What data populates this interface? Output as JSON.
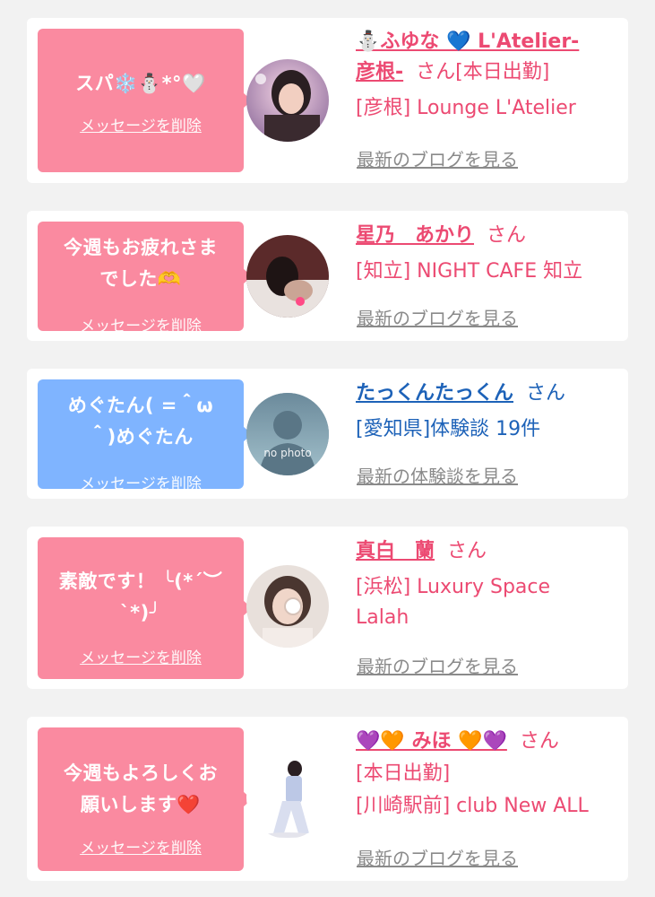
{
  "cards": [
    {
      "bubble_color": "#fa8aa0",
      "message": "スパ❄️⛄*°🤍",
      "delete_label": "メッセージを削除",
      "avatar": "woman-with-heart-sticker-photo",
      "name_line1": "⛄ふゆな 💙 L'Atelier-",
      "name_line2": "彦根-",
      "san": "さん",
      "status": "[本日出勤]",
      "shop": "[彦根] Lounge L'Atelier",
      "more_label": "最新のブログを見る"
    },
    {
      "bubble_color": "#fa8aa0",
      "message_line1": "今週もお疲れさま",
      "message_line2": "でした🫶",
      "delete_label": "メッセージを削除",
      "avatar": "woman-photo-dark",
      "name": "星乃　あかり",
      "san": "さん",
      "shop": "[知立] NIGHT CAFE 知立",
      "more_label": "最新のブログを見る"
    },
    {
      "bubble_color": "#7fb4ff",
      "message_line1": "めぐたん( =＾ω",
      "message_line2": "＾)めぐたん",
      "delete_label": "メッセージを削除",
      "avatar": "no-photo-silhouette",
      "avatar_text": "no photo",
      "name": "たっくんたっくん",
      "san": "さん",
      "shop": "[愛知県]体験談 19件",
      "more_label": "最新の体験談を見る"
    },
    {
      "bubble_color": "#fa8aa0",
      "message_line1": "素敵です！ ╰(*´︶",
      "message_line2": "`*)╯",
      "delete_label": "メッセージを削除",
      "avatar": "woman-photo-bob-hair",
      "name": "真白　蘭",
      "san": "さん",
      "shop_line1": "[浜松] Luxury Space",
      "shop_line2": "Lalah",
      "more_label": "最新のブログを見る"
    },
    {
      "bubble_color": "#fa8aa0",
      "message_line1": "今週もよろしくお",
      "message_line2": "願いします❤️",
      "delete_label": "メッセージを削除",
      "avatar": "woman-full-body-photo",
      "name": "💜🧡 みほ 🧡💜",
      "san": "さん",
      "status": "[本日出勤]",
      "shop": "[川崎駅前] club New ALL",
      "more_label": "最新のブログを見る"
    }
  ]
}
